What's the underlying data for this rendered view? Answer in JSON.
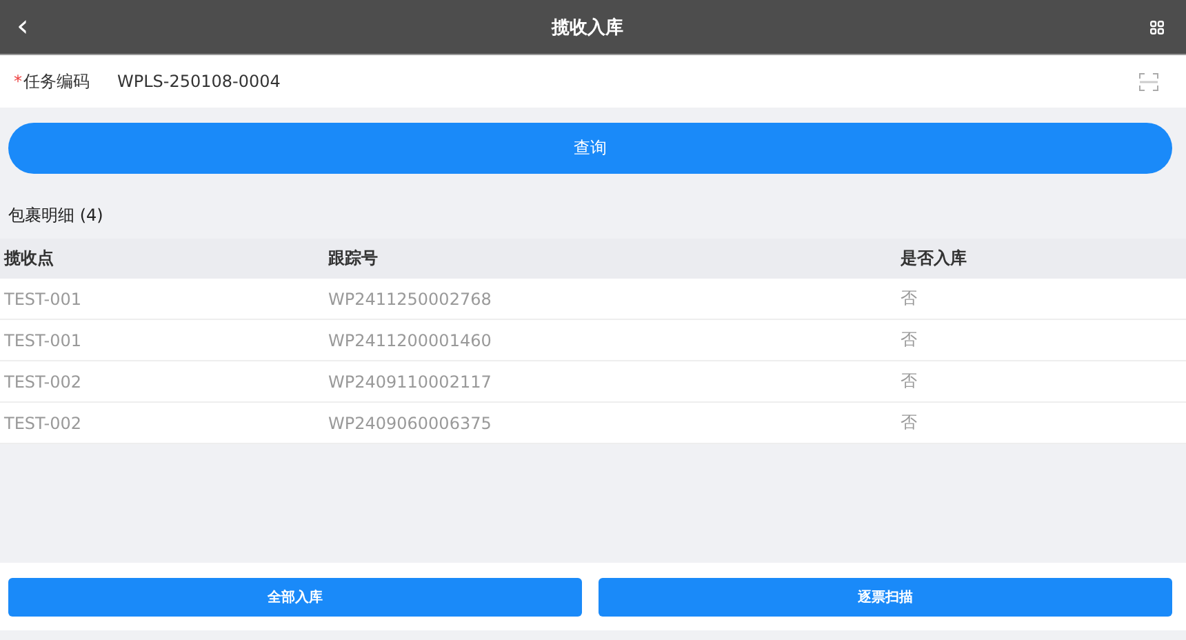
{
  "header": {
    "back_icon": "‹",
    "title": "揽收入库"
  },
  "form": {
    "required_mark": "*",
    "label": "任务编码",
    "value": "WPLS-250108-0004"
  },
  "query_button": "查询",
  "section_title": "包裹明细 (4)",
  "table": {
    "columns": [
      "揽收点",
      "跟踪号",
      "是否入库"
    ],
    "rows": [
      [
        "TEST-001",
        "WP2411250002768",
        "否"
      ],
      [
        "TEST-001",
        "WP2411200001460",
        "否"
      ],
      [
        "TEST-002",
        "WP2409110002117",
        "否"
      ],
      [
        "TEST-002",
        "WP2409060006375",
        "否"
      ]
    ]
  },
  "footer_buttons": [
    "全部入库",
    "逐票扫描"
  ]
}
